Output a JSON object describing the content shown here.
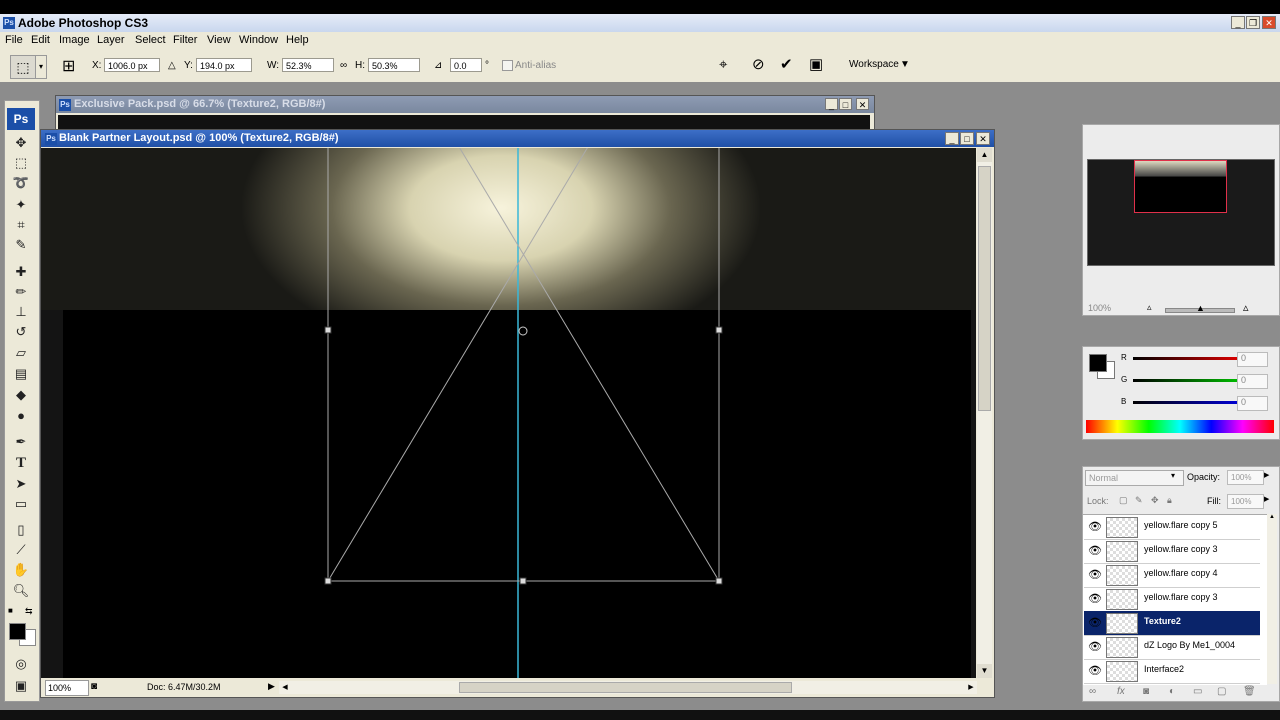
{
  "app": {
    "title": "Adobe Photoshop CS3"
  },
  "menu": [
    "File",
    "Edit",
    "Image",
    "Layer",
    "Select",
    "Filter",
    "View",
    "Window",
    "Help"
  ],
  "options": {
    "x_label": "X:",
    "x_value": "1006.0 px",
    "y_label": "Y:",
    "y_value": "194.0 px",
    "w_label": "W:",
    "w_value": "52.3%",
    "h_label": "H:",
    "h_value": "50.3%",
    "angle_value": "0.0",
    "angle_unit": "°",
    "antialias": "Anti-alias",
    "workspace": "Workspace"
  },
  "documents": {
    "back": {
      "title": "Exclusive Pack.psd @ 66.7% (Texture2, RGB/8#)"
    },
    "front": {
      "title": "Blank Partner Layout.psd @ 100% (Texture2, RGB/8#)",
      "zoom": "100%",
      "doc_info": "Doc: 6.47M/30.2M"
    }
  },
  "navigator": {
    "zoom": "100%"
  },
  "color": {
    "r_label": "R",
    "g_label": "G",
    "b_label": "B",
    "r_value": "0",
    "g_value": "0",
    "b_value": "0",
    "r_color": "#e00000",
    "g_color": "#00c000",
    "b_color": "#0000d8"
  },
  "layers_panel": {
    "blend_mode": "Normal",
    "opacity_label": "Opacity:",
    "opacity_value": "100%",
    "lock_label": "Lock:",
    "fill_label": "Fill:",
    "fill_value": "100%",
    "layers": [
      {
        "name": "yellow.flare copy 5",
        "selected": false
      },
      {
        "name": "yellow.flare copy 3",
        "selected": false
      },
      {
        "name": "yellow.flare copy 4",
        "selected": false
      },
      {
        "name": "yellow.flare copy 3",
        "selected": false
      },
      {
        "name": "Texture2",
        "selected": true
      },
      {
        "name": "dZ Logo By Me1_0004",
        "selected": false
      },
      {
        "name": "Interface2",
        "selected": false
      }
    ]
  }
}
